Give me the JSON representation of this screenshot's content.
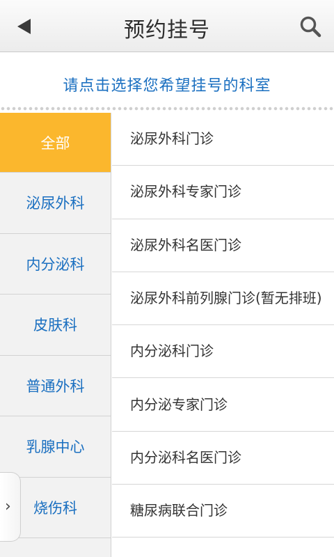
{
  "header": {
    "title": "预约挂号",
    "back_icon": "back-arrow-icon",
    "search_icon": "search-icon"
  },
  "hint": "请点击选择您希望挂号的科室",
  "categories": [
    {
      "label": "全部",
      "active": true
    },
    {
      "label": "泌尿外科",
      "active": false
    },
    {
      "label": "内分泌科",
      "active": false
    },
    {
      "label": "皮肤科",
      "active": false
    },
    {
      "label": "普通外科",
      "active": false
    },
    {
      "label": "乳腺中心",
      "active": false
    },
    {
      "label": "烧伤科",
      "active": false
    }
  ],
  "departments": [
    "泌尿外科门诊",
    "泌尿外科专家门诊",
    "泌尿外科名医门诊",
    "泌尿外科前列腺门诊(暂无排班)",
    "内分泌科门诊",
    "内分泌专家门诊",
    "内分泌科名医门诊",
    "糖尿病联合门诊"
  ],
  "side_handle_glyph": "›",
  "colors": {
    "accent": "#fbb72d",
    "link": "#1a6fc0"
  }
}
